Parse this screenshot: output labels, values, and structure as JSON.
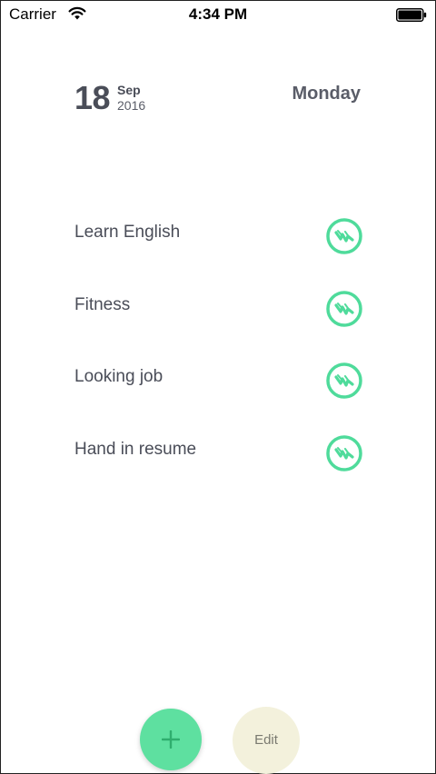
{
  "status_bar": {
    "carrier": "Carrier",
    "time": "4:34 PM",
    "wifi_icon": "wifi-icon",
    "battery_icon": "battery-icon"
  },
  "header": {
    "day": "18",
    "month": "Sep",
    "year": "2016",
    "weekday": "Monday"
  },
  "tasks": [
    {
      "label": "Learn English",
      "icon": "check-stamp-icon"
    },
    {
      "label": "Fitness",
      "icon": "check-stamp-icon"
    },
    {
      "label": "Looking job",
      "icon": "check-stamp-icon"
    },
    {
      "label": "Hand in resume",
      "icon": "check-stamp-icon"
    }
  ],
  "actions": {
    "add_icon": "plus-icon",
    "edit_label": "Edit"
  },
  "colors": {
    "accent_green": "#4fdb9b",
    "add_button": "#5ee0a0",
    "edit_button": "#f3f1dc",
    "text": "#4a4d58"
  }
}
